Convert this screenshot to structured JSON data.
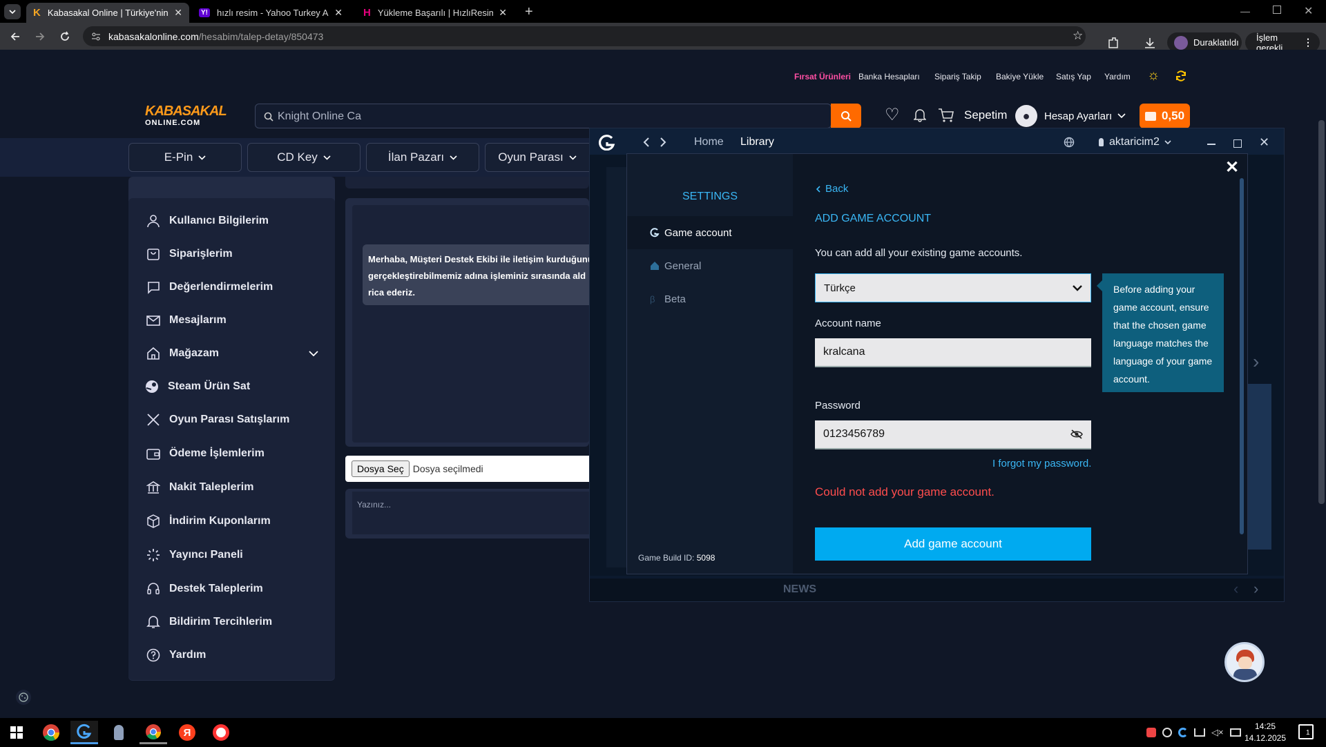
{
  "browser": {
    "tabs": [
      {
        "title": "Kabasakal Online | Türkiye'nin En",
        "active": true
      },
      {
        "title": "hızlı resim - Yahoo Turkey Aram",
        "active": false
      },
      {
        "title": "Yükleme Başarılı | HızlıResim",
        "active": false
      }
    ],
    "url_host": "kabasakalonline.com",
    "url_path": "/hesabim/talep-detay/850473",
    "paused_label": "Duraklatıldı",
    "action_label": "İşlem gerekli"
  },
  "site": {
    "logo_top": "KABASAKAL",
    "logo_bottom": "ONLINE.COM",
    "top_links": [
      "Fırsat Ürünleri",
      "Banka Hesapları",
      "Sipariş Takip",
      "Bakiye Yükle",
      "Satış Yap",
      "Yardım"
    ],
    "search_value": "Knight Online Ca",
    "cart_label": "Sepetim",
    "account_label": "Hesap Ayarları",
    "balance": "0,50",
    "categories": [
      "E-Pin",
      "CD Key",
      "İlan Pazarı",
      "Oyun Parası"
    ],
    "sidebar": [
      "Kullanıcı Bilgilerim",
      "Siparişlerim",
      "Değerlendirmelerim",
      "Mesajlarım",
      "Mağazam",
      "Steam Ürün Sat",
      "Oyun Parası Satışlarım",
      "Ödeme İşlemlerim",
      "Nakit Taleplerim",
      "İndirim Kuponlarım",
      "Yayıncı Paneli",
      "Destek Taleplerim",
      "Bildirim Tercihlerim",
      "Yardım"
    ],
    "message_text": "Merhaba, Müşteri Destek Ekibi ile iletişim kurduğunu gerçekleştirebilmemiz adına işleminiz sırasında ald rica ederiz.",
    "file_button": "Dosya Seç",
    "file_status": "Dosya seçilmedi",
    "reply_placeholder": "Yazınız..."
  },
  "app": {
    "nav_home": "Home",
    "nav_library": "Library",
    "username": "aktaricim2",
    "news_label": "NEWS",
    "settings_title": "SETTINGS",
    "settings_menu": [
      "Game account",
      "General",
      "Beta"
    ],
    "build_label": "Game Build ID:",
    "build_id": "5098",
    "back_label": "Back",
    "heading": "ADD GAME ACCOUNT",
    "subtitle": "You can add all your existing game accounts.",
    "language": "Türkçe",
    "account_label": "Account name",
    "account_value": "kralcana",
    "password_label": "Password",
    "password_value": "0123456789",
    "forgot": "I forgot my password.",
    "error": "Could not add your game account.",
    "submit": "Add game account",
    "tooltip": "Before adding your game account, ensure that the chosen game language matches the language of your game account."
  },
  "taskbar": {
    "time": "14:25",
    "date": "14.12.2025",
    "notif_count": "1"
  },
  "colors": {
    "accent_blue": "#00aaf0",
    "error_red": "#ff4d4d",
    "orange": "#ff6a00",
    "tooltip_bg": "#0e5f7d"
  }
}
